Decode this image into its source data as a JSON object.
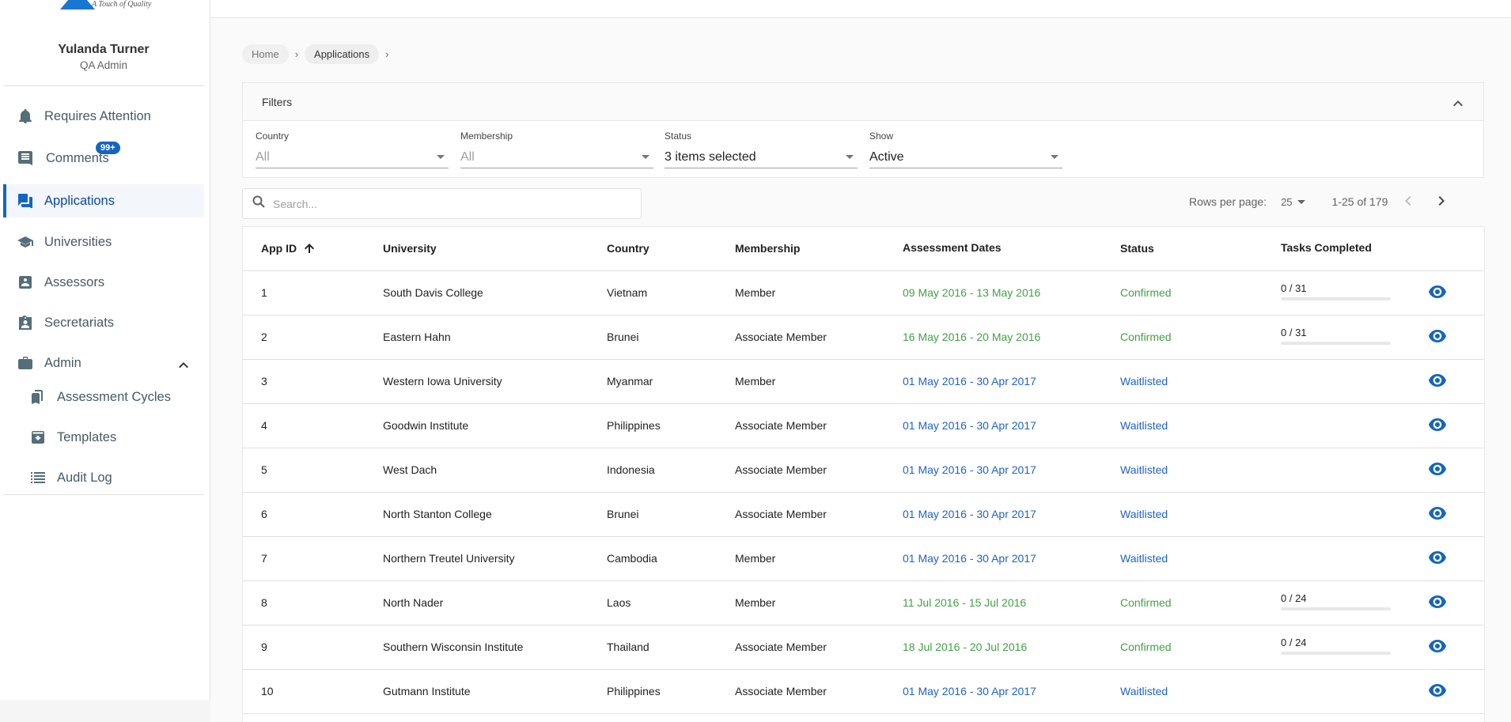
{
  "brand": {
    "tagline": "A Touch of Quality"
  },
  "user": {
    "name": "Yulanda Turner",
    "role": "QA Admin"
  },
  "nav": {
    "requires_attention": "Requires Attention",
    "comments": "Comments",
    "comments_badge": "99+",
    "applications": "Applications",
    "universities": "Universities",
    "assessors": "Assessors",
    "secretariats": "Secretariats",
    "admin": "Admin",
    "assessment_cycles": "Assessment Cycles",
    "templates": "Templates",
    "audit_log": "Audit Log"
  },
  "breadcrumb": {
    "home": "Home",
    "current": "Applications"
  },
  "filters": {
    "title": "Filters",
    "country": {
      "label": "Country",
      "value": "All"
    },
    "membership": {
      "label": "Membership",
      "value": "All"
    },
    "status": {
      "label": "Status",
      "value": "3 items selected"
    },
    "show": {
      "label": "Show",
      "value": "Active"
    }
  },
  "search": {
    "placeholder": "Search..."
  },
  "pagination": {
    "rows_label": "Rows per page:",
    "rows_value": "25",
    "range": "1-25 of 179"
  },
  "table": {
    "headers": {
      "app_id": "App ID",
      "university": "University",
      "country": "Country",
      "membership": "Membership",
      "dates": "Assessment Dates",
      "status": "Status",
      "tasks": "Tasks Completed"
    },
    "rows": [
      {
        "id": "1",
        "university": "South Davis College",
        "country": "Vietnam",
        "membership": "Member",
        "dates": "09 May 2016 - 13 May 2016",
        "status": "Confirmed",
        "tasks": "0 / 31",
        "progress": 0
      },
      {
        "id": "2",
        "university": "Eastern Hahn",
        "country": "Brunei",
        "membership": "Associate Member",
        "dates": "16 May 2016 - 20 May 2016",
        "status": "Confirmed",
        "tasks": "0 / 31",
        "progress": 0
      },
      {
        "id": "3",
        "university": "Western Iowa University",
        "country": "Myanmar",
        "membership": "Member",
        "dates": "01 May 2016 - 30 Apr 2017",
        "status": "Waitlisted",
        "tasks": "",
        "progress": null
      },
      {
        "id": "4",
        "university": "Goodwin Institute",
        "country": "Philippines",
        "membership": "Associate Member",
        "dates": "01 May 2016 - 30 Apr 2017",
        "status": "Waitlisted",
        "tasks": "",
        "progress": null
      },
      {
        "id": "5",
        "university": "West Dach",
        "country": "Indonesia",
        "membership": "Associate Member",
        "dates": "01 May 2016 - 30 Apr 2017",
        "status": "Waitlisted",
        "tasks": "",
        "progress": null
      },
      {
        "id": "6",
        "university": "North Stanton College",
        "country": "Brunei",
        "membership": "Associate Member",
        "dates": "01 May 2016 - 30 Apr 2017",
        "status": "Waitlisted",
        "tasks": "",
        "progress": null
      },
      {
        "id": "7",
        "university": "Northern Treutel University",
        "country": "Cambodia",
        "membership": "Member",
        "dates": "01 May 2016 - 30 Apr 2017",
        "status": "Waitlisted",
        "tasks": "",
        "progress": null
      },
      {
        "id": "8",
        "university": "North Nader",
        "country": "Laos",
        "membership": "Member",
        "dates": "11 Jul 2016 - 15 Jul 2016",
        "status": "Confirmed",
        "tasks": "0 / 24",
        "progress": 0
      },
      {
        "id": "9",
        "university": "Southern Wisconsin Institute",
        "country": "Thailand",
        "membership": "Associate Member",
        "dates": "18 Jul 2016 - 20 Jul 2016",
        "status": "Confirmed",
        "tasks": "0 / 24",
        "progress": 0
      },
      {
        "id": "10",
        "university": "Gutmann Institute",
        "country": "Philippines",
        "membership": "Associate Member",
        "dates": "01 May 2016 - 30 Apr 2017",
        "status": "Waitlisted",
        "tasks": "",
        "progress": null
      }
    ]
  },
  "colors": {
    "accent": "#1565c0",
    "confirmed": "#43a047",
    "waitlisted": "#1e63c6"
  }
}
